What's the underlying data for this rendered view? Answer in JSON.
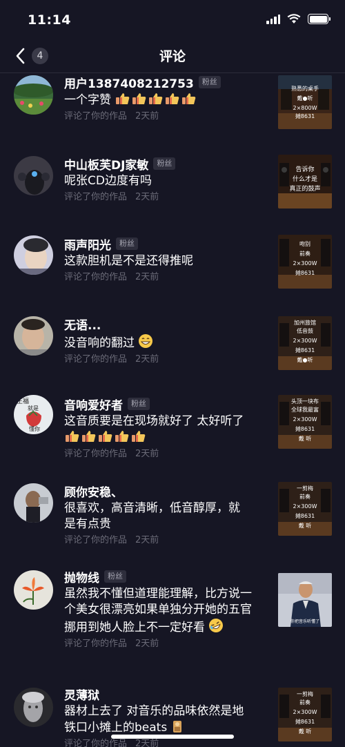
{
  "status_bar": {
    "time": "11:14"
  },
  "nav": {
    "title": "评论",
    "unread_count": "4"
  },
  "tag_fan": "粉丝",
  "comments": [
    {
      "name": "用户1387408212753",
      "fan": true,
      "text": "一个字赞",
      "emoji": "thumbs-up×5",
      "action": "评论了你的作品",
      "time": "2天前",
      "thumb_lines": [
        "熟悉的桌手",
        "戴●听",
        "2×800W",
        "摊8631"
      ]
    },
    {
      "name": "中山板芙DJ家敏",
      "fan": true,
      "text": "呢张CD边度有吗",
      "emoji": "",
      "action": "评论了你的作品",
      "time": "2天前",
      "thumb_lines": [
        "告诉你",
        "什么才是",
        "真正的鼓声"
      ]
    },
    {
      "name": "雨声阳光",
      "fan": true,
      "text": "这款胆机是不是还得推呢",
      "emoji": "",
      "action": "评论了你的作品",
      "time": "2天前",
      "thumb_lines": [
        "吻别",
        "前奏",
        "2×300W",
        "摊8631"
      ]
    },
    {
      "name": "无语...",
      "fan": false,
      "text": "没音响的翻过",
      "emoji": "grin",
      "action": "评论了你的作品",
      "time": "2天前",
      "thumb_lines": [
        "加州旅馆",
        "低音鼓",
        "2×300W",
        "摊8631",
        "戴●听"
      ]
    },
    {
      "name": "音响爱好者",
      "fan": true,
      "text": "这音质要是在现场就好了 太好听了",
      "emoji": "thumbs-up×5",
      "action": "评论了你的作品",
      "time": "2天前",
      "thumb_lines": [
        "头顶一块布",
        "全球我最富",
        "2×300W",
        "摊8631",
        "戴 听"
      ]
    },
    {
      "name": "顾你安稳、",
      "fan": false,
      "text": "很喜欢，高音清晰，低音醇厚，就是有点贵",
      "emoji": "",
      "action": "评论了你的作品",
      "time": "2天前",
      "thumb_lines": [
        "一剪梅",
        "前奏",
        "2×300W",
        "摊8631",
        "戴 听"
      ]
    },
    {
      "name": "抛物线",
      "fan": true,
      "text": "虽然我不懂但道理能理解，比方说一个美女很漂亮如果单独分开她的五官挪用到她人脸上不一定好看",
      "emoji": "rofl",
      "action": "评论了你的作品",
      "time": "2天前",
      "thumb_lines": []
    },
    {
      "name": "灵薄狱",
      "fan": false,
      "text": "器材上去了 对音乐的品味依然是地铁口小摊上的beats",
      "emoji": "figure",
      "action": "评论了你的作品",
      "time": "2天前",
      "thumb_lines": [
        "一剪梅",
        "前奏",
        "2×300W",
        "摊8631",
        "戴 听"
      ]
    }
  ],
  "colors": {
    "background": "#161624",
    "meta_text": "#6b6b78",
    "tag_bg": "#2e2e3c"
  }
}
